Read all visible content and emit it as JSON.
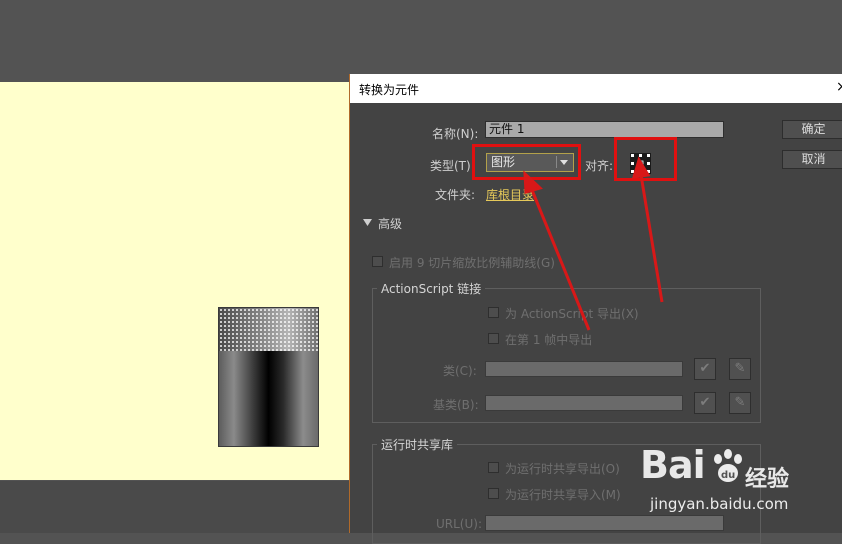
{
  "dialog": {
    "title": "转换为元件",
    "close": "×",
    "name_label": "名称(N):",
    "name_value": "元件 1",
    "type_label": "类型(T)",
    "type_value": "图形",
    "align_label": "对齐:",
    "folder_label": "文件夹:",
    "folder_value": "库根目录",
    "ok_label": "确定",
    "cancel_label": "取消",
    "advanced_label": "高级",
    "scale9_label": "启用 9 切片缩放比例辅助线(G)",
    "actionscript": {
      "title": "ActionScript 链接",
      "export_as": "为 ActionScript 导出(X)",
      "export_frame1": "在第 1 帧中导出",
      "class_label": "类(C):",
      "base_class_label": "基类(B):",
      "check_icon": "✔",
      "edit_icon": "✎"
    },
    "runtime": {
      "title": "运行时共享库",
      "export_runtime": "为运行时共享导出(O)",
      "import_runtime": "为运行时共享导入(M)",
      "url_label": "URL(U):"
    }
  },
  "watermark": {
    "logo": "Bai",
    "logo_paw": "du",
    "product": "经验",
    "url": "jingyan.baidu.com"
  },
  "colors": {
    "highlight_red": "#e01010",
    "stage_yellow": "#ffffcc",
    "panel_gray": "#434343",
    "link_gold": "#e6c95a"
  }
}
